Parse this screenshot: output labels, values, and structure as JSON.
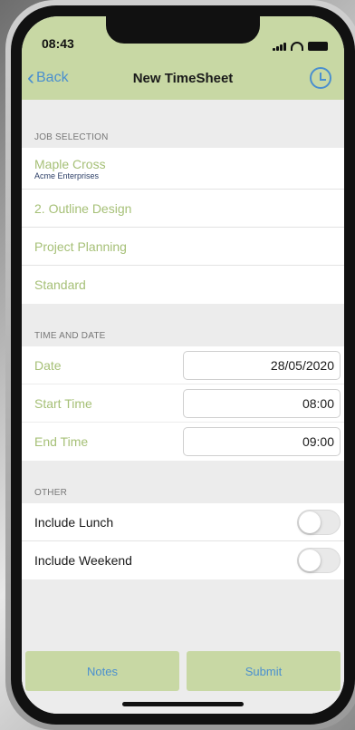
{
  "status": {
    "time": "08:43"
  },
  "nav": {
    "back_label": "Back",
    "title": "New TimeSheet",
    "history_icon": "history-icon"
  },
  "job_selection": {
    "header": "JOB SELECTION",
    "items": [
      {
        "primary": "Maple Cross",
        "secondary": "Acme Enterprises"
      },
      {
        "primary": "2. Outline Design"
      },
      {
        "primary": "Project Planning"
      },
      {
        "primary": "Standard"
      }
    ]
  },
  "time_and_date": {
    "header": "TIME AND DATE",
    "fields": [
      {
        "label": "Date",
        "value": "28/05/2020"
      },
      {
        "label": "Start Time",
        "value": "08:00"
      },
      {
        "label": "End Time",
        "value": "09:00"
      }
    ]
  },
  "other": {
    "header": "OTHER",
    "toggles": [
      {
        "label": "Include Lunch",
        "on": false
      },
      {
        "label": "Include Weekend",
        "on": false
      }
    ]
  },
  "actions": {
    "notes_label": "Notes",
    "submit_label": "Submit"
  },
  "colors": {
    "accent_green": "#c8d8a4",
    "link_blue": "#4a8fcf",
    "label_green": "#a6c077"
  }
}
